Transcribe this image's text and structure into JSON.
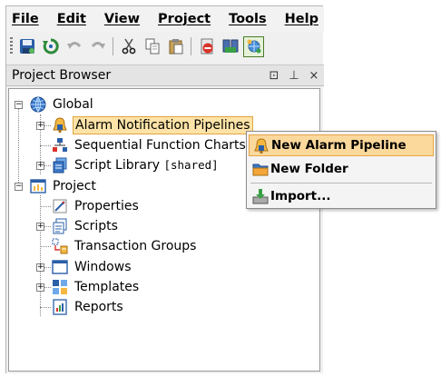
{
  "menubar": {
    "items": [
      "File",
      "Edit",
      "View",
      "Project",
      "Tools",
      "Help"
    ]
  },
  "toolbar": {
    "buttons": [
      "save-icon",
      "refresh-icon",
      "undo-icon",
      "redo-icon",
      "cut-icon",
      "copy-icon",
      "paste-icon",
      "stop-icon",
      "publish-icon",
      "network-icon"
    ],
    "active": "network-icon"
  },
  "panel": {
    "title": "Project Browser",
    "controls": [
      "⊡",
      "⊥",
      "×"
    ]
  },
  "tree": {
    "global": {
      "label": "Global",
      "children": [
        {
          "label": "Alarm Notification Pipelines",
          "selected": true,
          "expandable": true
        },
        {
          "label": "Sequential Function Charts",
          "expandable": false
        },
        {
          "label": "Script Library",
          "suffix": "[shared]",
          "expandable": true
        }
      ]
    },
    "project": {
      "label": "Project",
      "children": [
        {
          "label": "Properties",
          "expandable": false
        },
        {
          "label": "Scripts",
          "expandable": true
        },
        {
          "label": "Transaction Groups",
          "expandable": false
        },
        {
          "label": "Windows",
          "expandable": true
        },
        {
          "label": "Templates",
          "expandable": true
        },
        {
          "label": "Reports",
          "expandable": false
        }
      ]
    }
  },
  "context_menu": {
    "items": [
      {
        "label": "New Alarm Pipeline",
        "highlighted": true
      },
      {
        "label": "New Folder",
        "highlighted": false
      },
      {
        "label": "Import...",
        "highlighted": false
      }
    ]
  },
  "colors": {
    "selection_bg": "#fde3a7",
    "selection_border": "#e0a640",
    "menu_highlight": "#fbd89b"
  }
}
